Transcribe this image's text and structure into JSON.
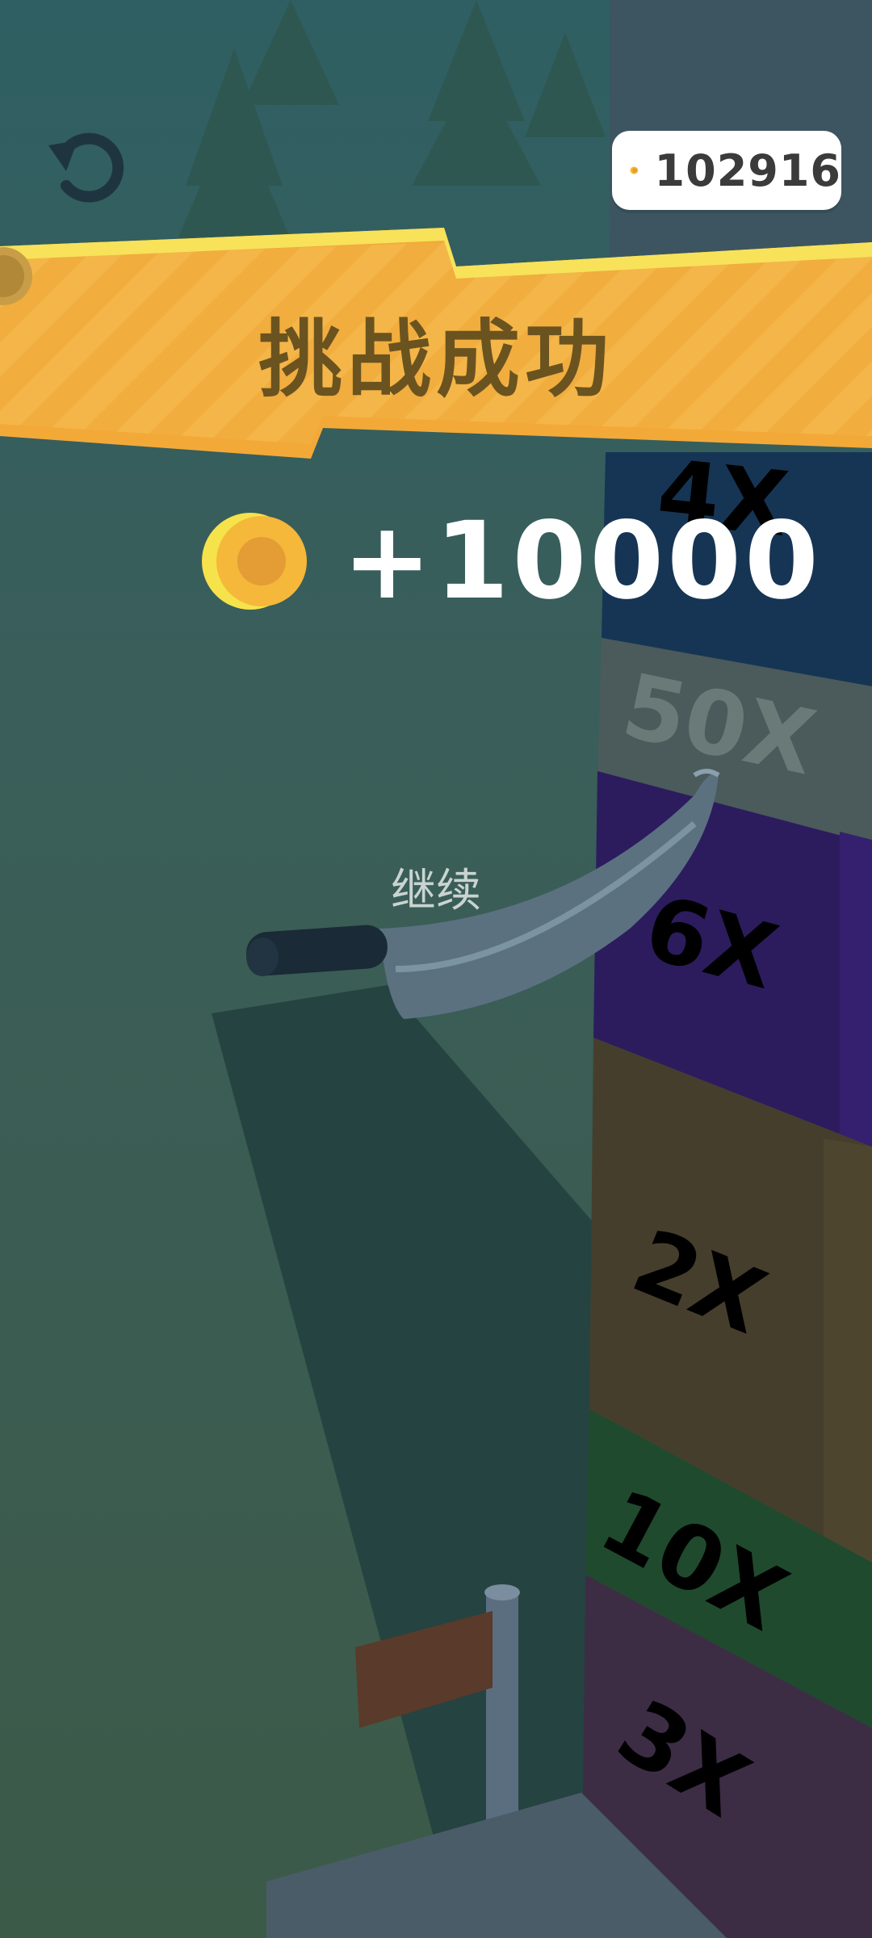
{
  "hud": {
    "restart_icon": "restart-icon",
    "coin_icon": "coin-icon",
    "coin_total": "102916"
  },
  "result": {
    "title": "挑战成功",
    "reward": "+10000",
    "continue_label": "继续"
  },
  "tower": {
    "multipliers": [
      "4X",
      "50X",
      "6X",
      "2X",
      "10X",
      "3X"
    ]
  },
  "colors": {
    "background": "#3a5a50",
    "banner": "#f2b040",
    "banner_text": "#6b5320",
    "coin": "#f6c63c"
  }
}
